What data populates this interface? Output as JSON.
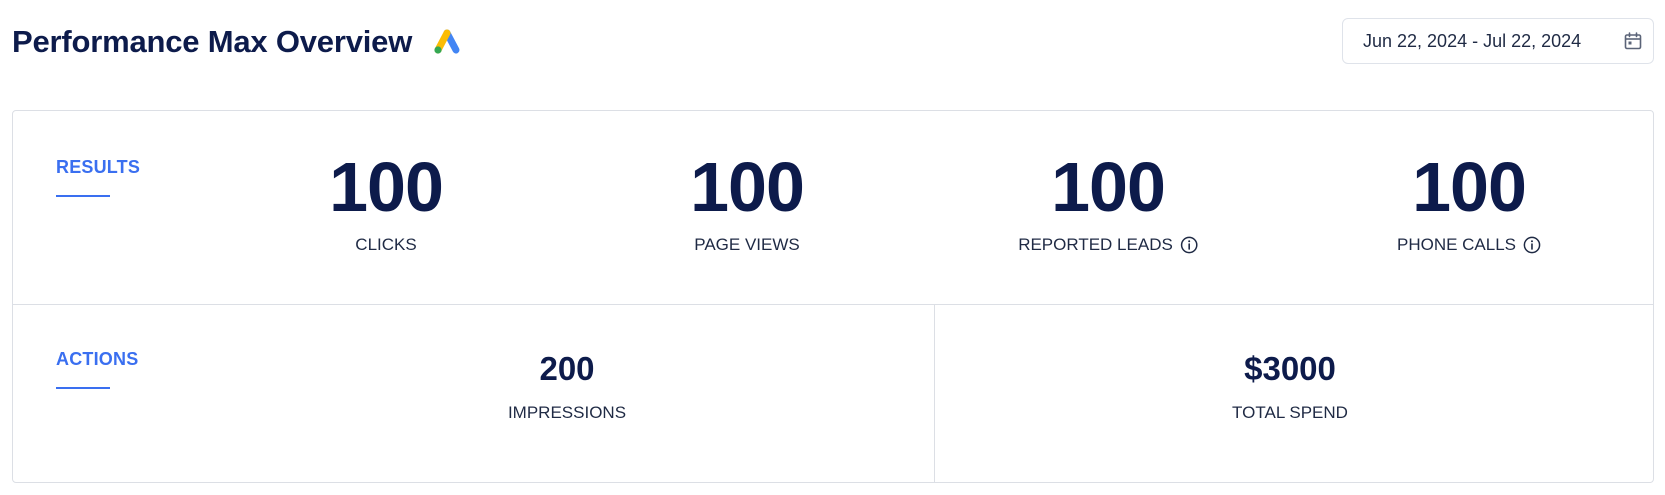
{
  "header": {
    "title": "Performance Max Overview",
    "logo_icon": "google-ads-icon",
    "date_range": "Jun 22, 2024 - Jul 22, 2024",
    "date_icon": "calendar-icon"
  },
  "results": {
    "section_label": "RESULTS",
    "stats": [
      {
        "value": "100",
        "label": "CLICKS",
        "info": false
      },
      {
        "value": "100",
        "label": "PAGE VIEWS",
        "info": false
      },
      {
        "value": "100",
        "label": "REPORTED LEADS",
        "info": true
      },
      {
        "value": "100",
        "label": "PHONE CALLS",
        "info": true
      }
    ]
  },
  "actions": {
    "section_label": "ACTIONS",
    "stats": [
      {
        "value": "200",
        "label": "IMPRESSIONS"
      },
      {
        "value": "$3000",
        "label": "TOTAL SPEND"
      }
    ]
  },
  "colors": {
    "accent": "#3a6ff0",
    "text_dark": "#0d1b4b",
    "border": "#dcdfe5"
  }
}
